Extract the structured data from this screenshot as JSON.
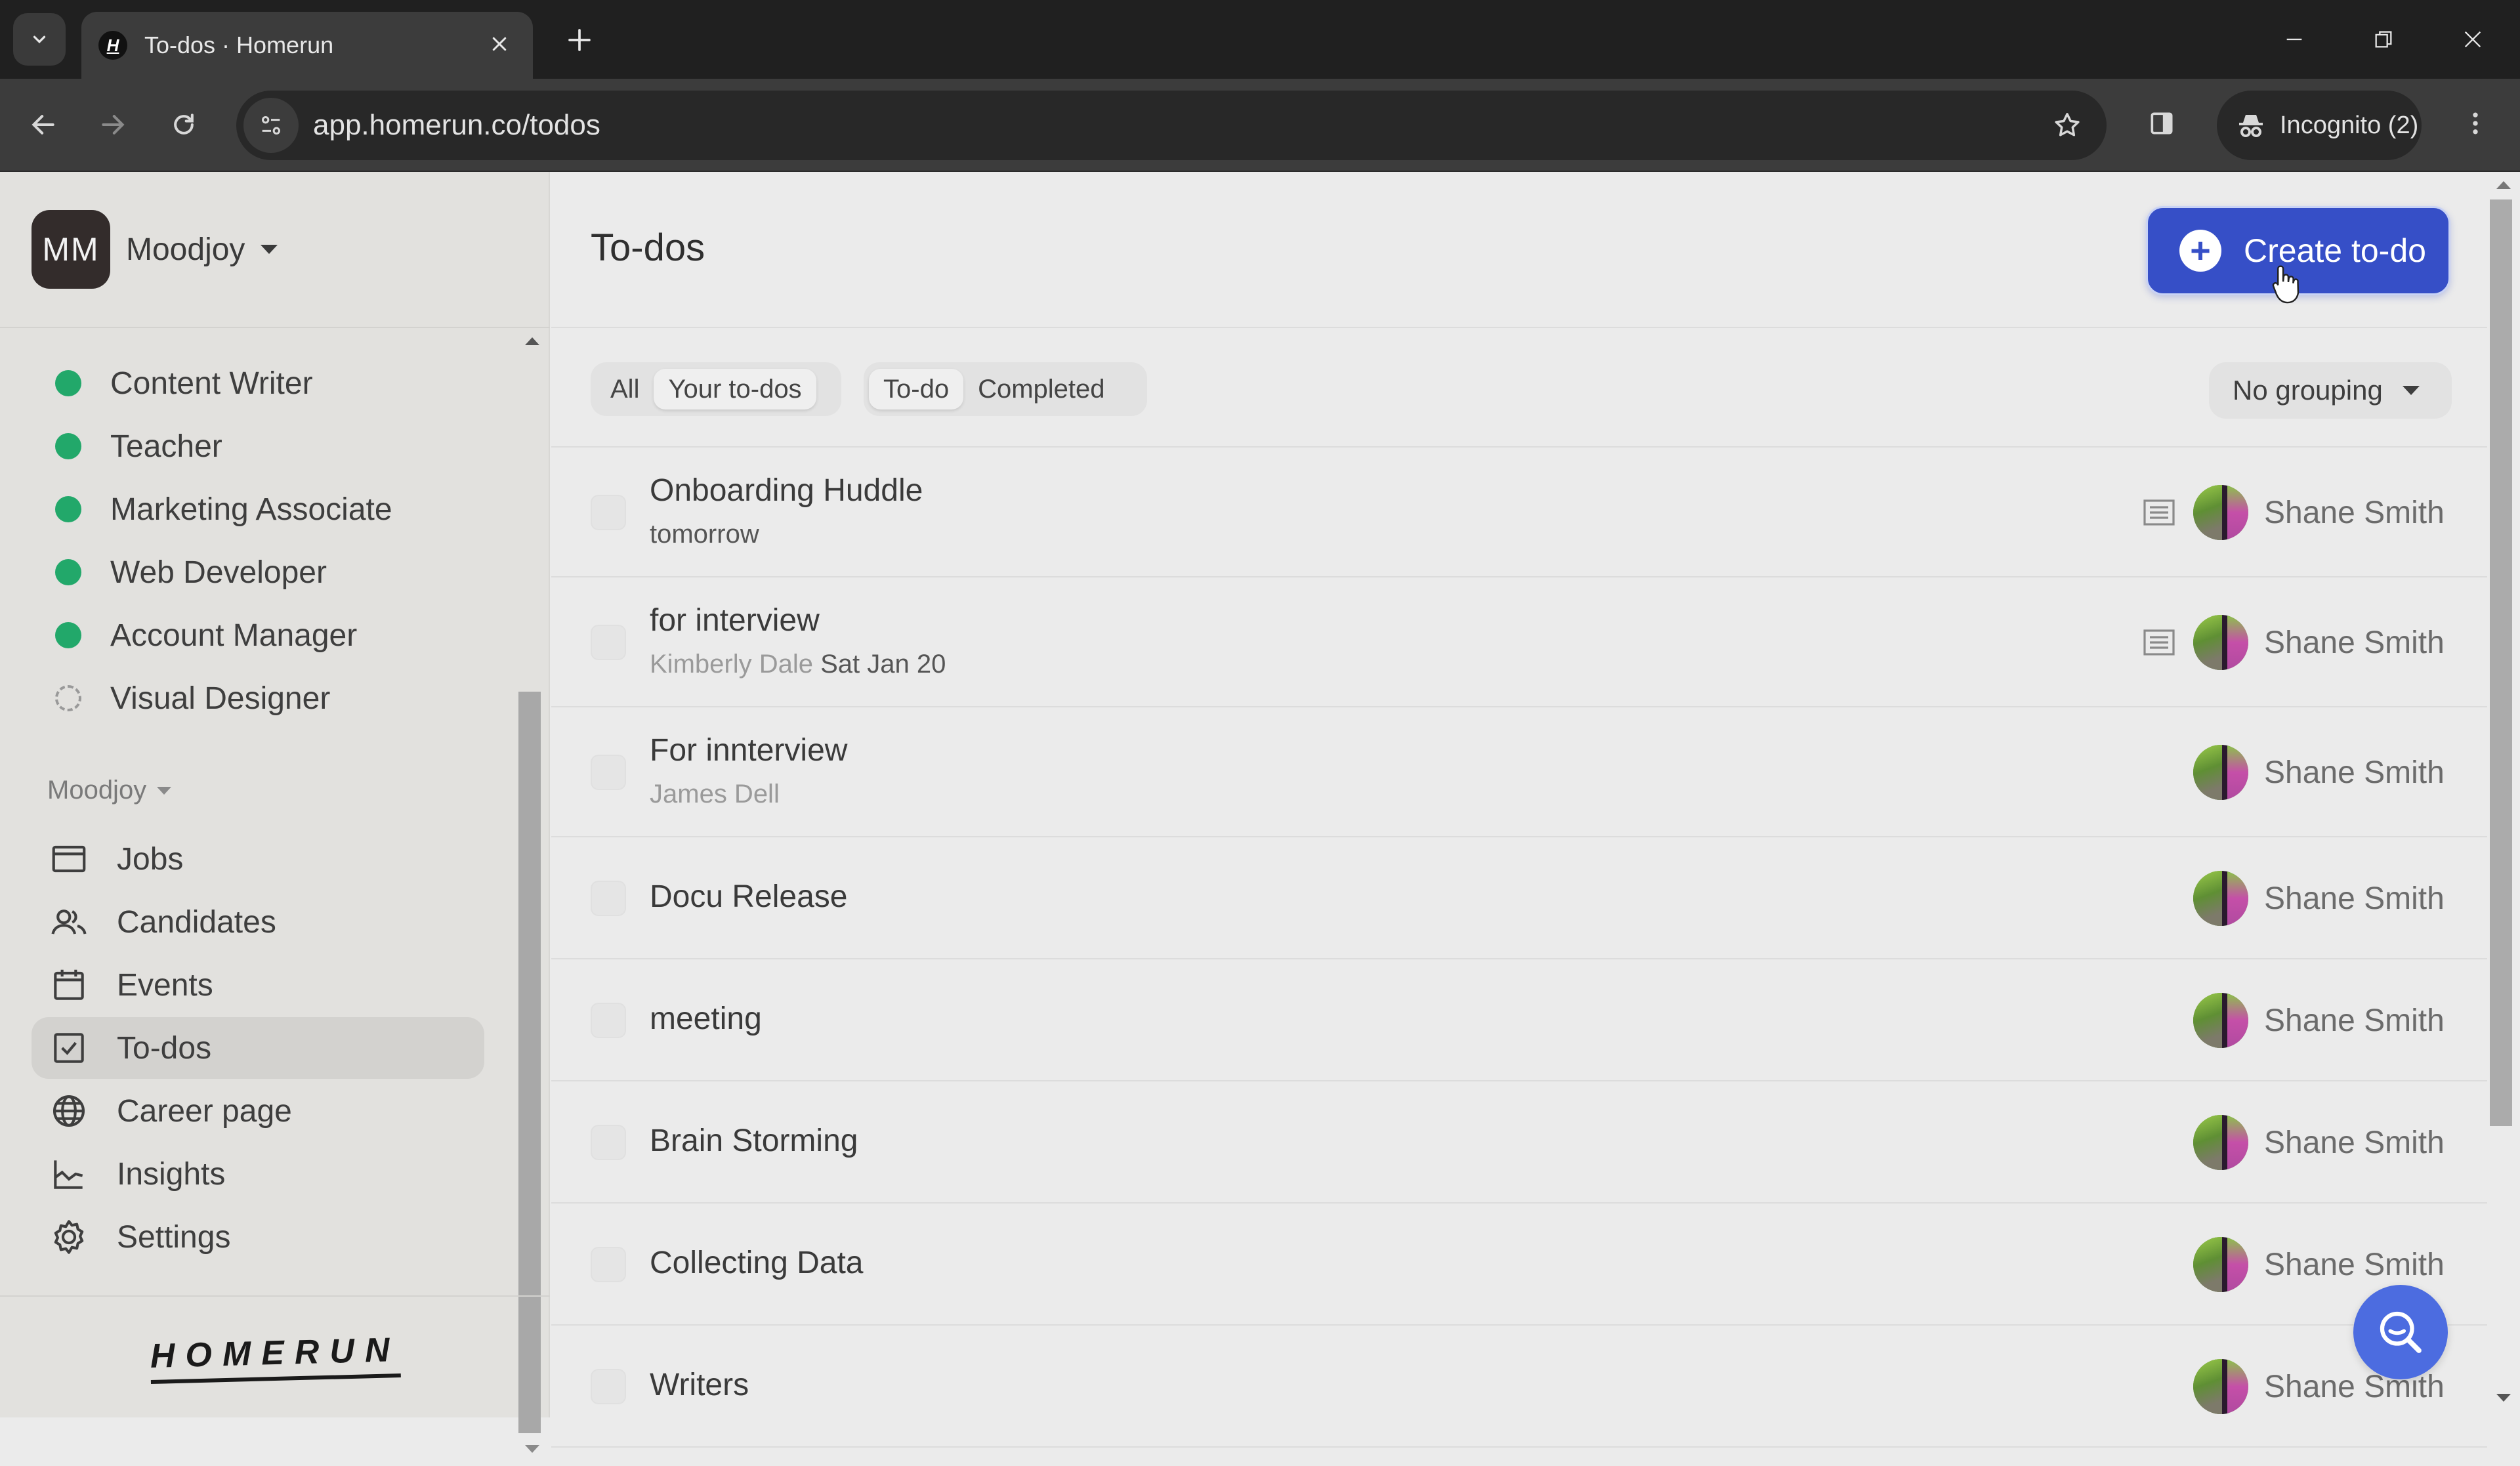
{
  "browser": {
    "tab_title": "To-dos · Homerun",
    "tab_favicon_letter": "H",
    "url": "app.homerun.co/todos",
    "incognito_label": "Incognito (2)",
    "new_tab_symbol": "+",
    "close_tab_symbol": "✕"
  },
  "sidebar": {
    "org_initials": "MM",
    "org_name": "Moodjoy",
    "jobs": [
      {
        "label": "Content Writer",
        "status": "published"
      },
      {
        "label": "Teacher",
        "status": "published"
      },
      {
        "label": "Marketing Associate",
        "status": "published"
      },
      {
        "label": "Web Developer",
        "status": "published"
      },
      {
        "label": "Account Manager",
        "status": "published"
      },
      {
        "label": "Visual Designer",
        "status": "draft"
      }
    ],
    "section_label": "Moodjoy",
    "nav": [
      {
        "label": "Jobs",
        "icon": "jobs-icon"
      },
      {
        "label": "Candidates",
        "icon": "candidates-icon"
      },
      {
        "label": "Events",
        "icon": "calendar-icon"
      },
      {
        "label": "To-dos",
        "icon": "checkbox-icon",
        "active": true
      },
      {
        "label": "Career page",
        "icon": "globe-icon"
      },
      {
        "label": "Insights",
        "icon": "chart-icon"
      },
      {
        "label": "Settings",
        "icon": "gear-icon"
      }
    ],
    "logo": "HOMERUN"
  },
  "main": {
    "title": "To-dos",
    "create_button": "Create to-do",
    "filters": {
      "scope": [
        {
          "label": "All",
          "selected": false
        },
        {
          "label": "Your to-dos",
          "selected": true
        }
      ],
      "status": [
        {
          "label": "To-do",
          "selected": true
        },
        {
          "label": "Completed",
          "selected": false
        }
      ]
    },
    "grouping": "No grouping",
    "todos": [
      {
        "title": "Onboarding Huddle",
        "subtitle_muted": "",
        "subtitle_strong": "tomorrow",
        "has_note": true,
        "assignee": "Shane Smith"
      },
      {
        "title": "for interview",
        "subtitle_muted": "Kimberly Dale",
        "subtitle_strong": "Sat Jan 20",
        "has_note": true,
        "assignee": "Shane Smith"
      },
      {
        "title": "For innterview",
        "subtitle_muted": "James Dell",
        "subtitle_strong": "",
        "has_note": false,
        "assignee": "Shane Smith"
      },
      {
        "title": "Docu Release",
        "subtitle_muted": "",
        "subtitle_strong": "",
        "has_note": false,
        "assignee": "Shane Smith"
      },
      {
        "title": "meeting",
        "subtitle_muted": "",
        "subtitle_strong": "",
        "has_note": false,
        "assignee": "Shane Smith"
      },
      {
        "title": "Brain Storming",
        "subtitle_muted": "",
        "subtitle_strong": "",
        "has_note": false,
        "assignee": "Shane Smith"
      },
      {
        "title": "Collecting Data",
        "subtitle_muted": "",
        "subtitle_strong": "",
        "has_note": false,
        "assignee": "Shane Smith"
      },
      {
        "title": "Writers",
        "subtitle_muted": "",
        "subtitle_strong": "",
        "has_note": false,
        "assignee": "Shane Smith"
      }
    ]
  },
  "colors": {
    "accent": "#364fc7",
    "status_published": "#22a86a",
    "search_fab": "#4c6ce0"
  }
}
